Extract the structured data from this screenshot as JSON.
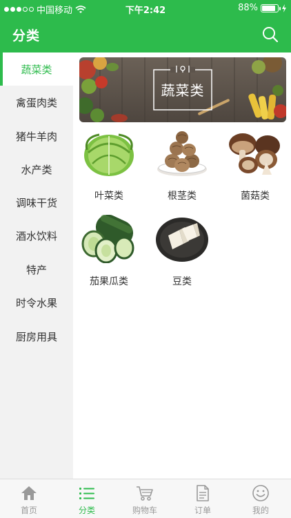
{
  "status_bar": {
    "carrier": "中国移动",
    "time": "下午2:42",
    "battery": "88%",
    "battery_level": 0.88
  },
  "header": {
    "title": "分类"
  },
  "sidebar": {
    "items": [
      {
        "label": "蔬菜类",
        "active": true
      },
      {
        "label": "禽蛋肉类"
      },
      {
        "label": "猪牛羊肉"
      },
      {
        "label": "水产类"
      },
      {
        "label": "调味干货"
      },
      {
        "label": "酒水饮料"
      },
      {
        "label": "特产"
      },
      {
        "label": "时令水果"
      },
      {
        "label": "厨房用具"
      }
    ]
  },
  "banner": {
    "title": "蔬菜类"
  },
  "categories": [
    {
      "label": "叶菜类",
      "icon": "cabbage-icon"
    },
    {
      "label": "根茎类",
      "icon": "taro-icon"
    },
    {
      "label": "菌菇类",
      "icon": "mushroom-icon"
    },
    {
      "label": "茄果瓜类",
      "icon": "winter-melon-icon"
    },
    {
      "label": "豆类",
      "icon": "tofu-icon"
    }
  ],
  "tabbar": {
    "tabs": [
      {
        "label": "首页",
        "icon": "home-icon"
      },
      {
        "label": "分类",
        "icon": "list-icon",
        "active": true
      },
      {
        "label": "购物车",
        "icon": "cart-icon"
      },
      {
        "label": "订单",
        "icon": "document-icon"
      },
      {
        "label": "我的",
        "icon": "smiley-icon"
      }
    ]
  },
  "colors": {
    "brand": "#2dbb4c",
    "sidebar_bg": "#f2f2f2",
    "tab_inactive": "#999999"
  }
}
